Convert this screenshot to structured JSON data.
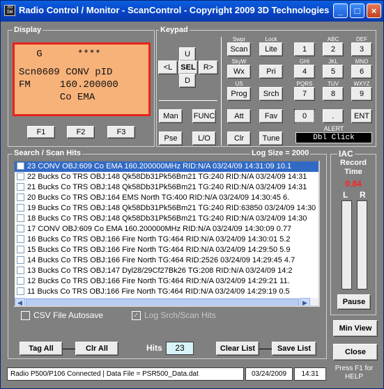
{
  "window": {
    "title": "Radio Control / Monitor - ScanControl - Copyright 2009 3D Technologies",
    "icon_label": "3D SW"
  },
  "display": {
    "label": "Display",
    "line1": "   G      ****",
    "line2": "Scn0609 CONV pID",
    "line3": "FM     160.200000",
    "line4": "       Co EMA",
    "f1": "F1",
    "f2": "F2",
    "f3": "F3"
  },
  "keypad": {
    "label": "Keypad",
    "nav": {
      "up": "U",
      "left": "<L",
      "sel": "SEL",
      "right": "R>",
      "down": "D"
    },
    "man": "Man",
    "func": "FUNC",
    "pse": "Pse",
    "lo": "L/O",
    "swpr_label": "Swpr",
    "scan": "Scan",
    "lock_label": "Lock",
    "lite": "Lite",
    "skyw_label": "SkyW",
    "wx": "Wx",
    "pri": "Pri",
    "us_label": "US",
    "prog": "Prog",
    "srch": "Srch",
    "att": "Att",
    "fav": "Fav",
    "clr": "Clr",
    "tune": "Tune",
    "digits": [
      {
        "sub": "",
        "key": "1"
      },
      {
        "sub": "ABC",
        "key": "2"
      },
      {
        "sub": "DEF",
        "key": "3"
      },
      {
        "sub": "GHI",
        "key": "4"
      },
      {
        "sub": "JKL",
        "key": "5"
      },
      {
        "sub": "MNO",
        "key": "6"
      },
      {
        "sub": "PQRS",
        "key": "7"
      },
      {
        "sub": "TUV",
        "key": "8"
      },
      {
        "sub": "WXYZ",
        "key": "9"
      }
    ],
    "zero": "0",
    "dot": ".",
    "ent": "ENT",
    "alert_label": "ALERT",
    "alert_value": "Dbl Click"
  },
  "hits": {
    "label": "Search / Scan Hits",
    "log_size": "Log Size = 2000",
    "rows": [
      "23  CONV  OBJ:609  Co EMA  160.200000MHz  RID:N/A  03/24/09  14:31:09  10.1",
      "22  Bucks Co TRS  OBJ:148  Qk58Db31Pk56Bm21  TG:240  RID:N/A  03/24/09  14:31",
      "21  Bucks Co TRS  OBJ:148  Qk58Db31Pk56Bm21  TG:240  RID:N/A  03/24/09  14:31",
      "20  Bucks Co TRS  OBJ:164  EMS North  TG:400  RID:N/A  03/24/09  14:30:45  6.",
      "19  Bucks Co TRS  OBJ:148  Qk58Db31Pk56Bm21  TG:240  RID:63850  03/24/09  14:30",
      "18  Bucks Co TRS  OBJ:148  Qk58Db31Pk56Bm21  TG:240  RID:N/A  03/24/09  14:30",
      "17  CONV  OBJ:609  Co EMA  160.200000MHz  RID:N/A  03/24/09  14:30:09  0.77",
      "16  Bucks Co TRS  OBJ:166  Fire North  TG:464  RID:N/A  03/24/09  14:30:01  5.2",
      "15  Bucks Co TRS  OBJ:166  Fire North  TG:464  RID:N/A  03/24/09  14:29:50  5.9",
      "14  Bucks Co TRS  OBJ:166  Fire North  TG:464  RID:2526  03/24/09  14:29:45  4.7",
      "13  Bucks Co TRS  OBJ:147  Dyl28/29Cf27Bk26  TG:208  RID:N/A  03/24/09  14:2",
      "12  Bucks Co TRS  OBJ:166  Fire North  TG:464  RID:N/A  03/24/09  14:29:21  11.",
      "11  Bucks Co TRS  OBJ:166  Fire North  TG:464  RID:N/A  03/24/09  14:29:19  0.5"
    ],
    "csv_autosave": "CSV File Autosave",
    "log_srch": "Log Srch/Scan Hits",
    "tag_all": "Tag All",
    "clr_all": "Clr All",
    "hits_label": "Hits",
    "hits_value": "23",
    "clear_list": "Clear List",
    "save_list": "Save List"
  },
  "iac": {
    "label": "IAC",
    "record_time_label": "Record Time",
    "record_time_value": "0.84",
    "left_label": "L",
    "right_label": "R",
    "pause": "Pause",
    "min_view": "Min View",
    "close": "Close"
  },
  "status": {
    "connection": "Radio P500/P106 Connected | Data File = PSR500_Data.dat",
    "date": "03/24/2009",
    "time": "14:31",
    "help": "Press F1 for HELP"
  },
  "colors": {
    "lcd_bg": "#f7b27a",
    "lcd_border": "#e8231b",
    "record_time": "#ff2020",
    "selection": "#316ac5",
    "panel": "#808080"
  }
}
